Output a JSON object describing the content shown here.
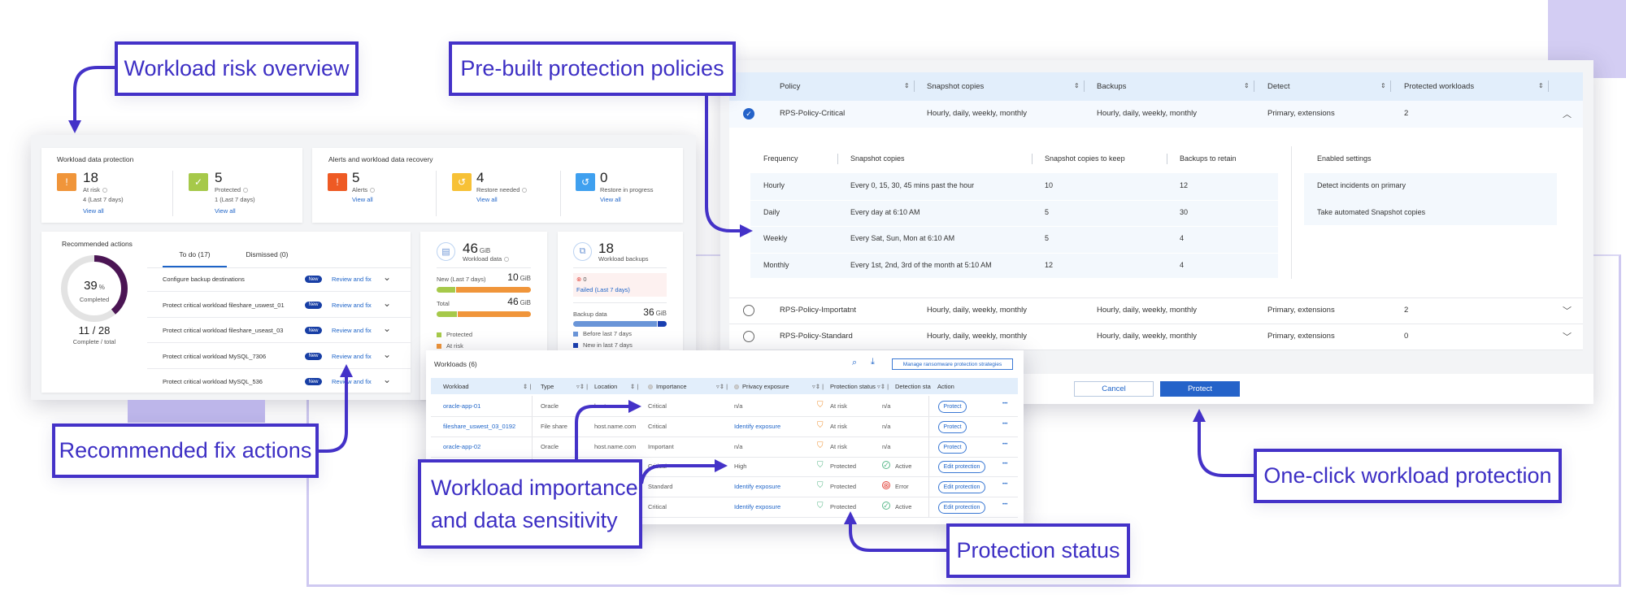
{
  "colors": {
    "accent": "#4432c8",
    "callout_text": "#3d2fc4",
    "link": "#1e64c8",
    "primary_button": "#2563c9",
    "badge": "#173ea5",
    "at_risk": "#f0953a",
    "protected": "#a6c94a",
    "alert": "#ee5a24",
    "restore_needed": "#f7c136",
    "restore_progress": "#3fa0ef",
    "ring": "#4b1554"
  },
  "callouts": {
    "risk_overview": "Workload risk overview",
    "policies": "Pre-built protection policies",
    "fix_actions": "Recommended fix actions",
    "importance": [
      "Workload importance",
      "and data sensitivity"
    ],
    "protection_status": "Protection status",
    "one_click": "One-click workload protection"
  },
  "dashboard": {
    "protection": {
      "title": "Workload data protection",
      "items": [
        {
          "value": "18",
          "label": "At risk",
          "sub": "4 (Last 7 days)",
          "link": "View all",
          "icon": "shield-alert-icon"
        },
        {
          "value": "5",
          "label": "Protected",
          "sub": "1 (Last 7 days)",
          "link": "View all",
          "icon": "shield-check-icon"
        }
      ]
    },
    "alerts": {
      "title": "Alerts and workload data recovery",
      "items": [
        {
          "value": "5",
          "label": "Alerts",
          "link": "View all",
          "icon": "alert-icon"
        },
        {
          "value": "4",
          "label": "Restore needed",
          "link": "View all",
          "icon": "restore-icon"
        },
        {
          "value": "0",
          "label": "Restore in progress",
          "link": "View all",
          "icon": "restore-progress-icon"
        }
      ]
    },
    "recommended": {
      "title": "Recommended actions",
      "percent": "39",
      "percent_unit": "%",
      "completed_label": "Completed",
      "progress": 0.39,
      "fraction": "11 / 28",
      "fraction_label": "Complete / total",
      "tabs": [
        "To do (17)",
        "Dismissed (0)"
      ],
      "active_tab": 0,
      "badge": "New",
      "action": "Review and fix",
      "rows": [
        "Configure backup destinations",
        "Protect critical workload fileshare_uswest_01",
        "Protect critical workload fileshare_useast_03",
        "Protect critical workload MySQL_7306",
        "Protect critical workload MySQL_536"
      ]
    },
    "workload_data": {
      "value": "46",
      "unit": "GiB",
      "label": "Workload data",
      "new_label": "New (Last 7 days)",
      "new_value": "10",
      "new_protected_pct": 20,
      "total_label": "Total",
      "total_value": "46",
      "total_protected_pct": 22,
      "legend": [
        "Protected",
        "At risk"
      ]
    },
    "backups": {
      "value": "18",
      "label": "Workload backups",
      "failed_count": "0",
      "failed_label": "Failed (Last 7 days)",
      "backup_label": "Backup data",
      "backup_value": "36",
      "unit": "GiB",
      "new_pct": 10,
      "legend": [
        "Before last 7 days",
        "New in last 7 days"
      ]
    }
  },
  "policies": {
    "headers": [
      "Policy",
      "Snapshot copies",
      "Backups",
      "Detect",
      "Protected workloads"
    ],
    "rows": [
      {
        "name": "RPS-Policy-Critical",
        "snapshots": "Hourly, daily, weekly, monthly",
        "backups": "Hourly, daily, weekly, monthly",
        "detect": "Primary, extensions",
        "protected": "2",
        "selected": true,
        "expanded": true
      },
      {
        "name": "RPS-Policy-Importatnt",
        "snapshots": "Hourly, daily, weekly, monthly",
        "backups": "Hourly, daily, weekly, monthly",
        "detect": "Primary, extensions",
        "protected": "2",
        "selected": false,
        "expanded": false
      },
      {
        "name": "RPS-Policy-Standard",
        "snapshots": "Hourly, daily, weekly, monthly",
        "backups": "Hourly, daily, weekly, monthly",
        "detect": "Primary, extensions",
        "protected": "0",
        "selected": false,
        "expanded": false
      }
    ],
    "detail": {
      "headers": [
        "Frequency",
        "Snapshot copies",
        "Snapshot copies to keep",
        "Backups to retain"
      ],
      "rows": [
        [
          "Hourly",
          "Every 0, 15, 30, 45 mins past the hour",
          "10",
          "12"
        ],
        [
          "Daily",
          "Every day at 6:10 AM",
          "5",
          "30"
        ],
        [
          "Weekly",
          "Every Sat, Sun, Mon at 6:10 AM",
          "5",
          "4"
        ],
        [
          "Monthly",
          "Every 1st, 2nd, 3rd of the month at 5:10 AM",
          "12",
          "4"
        ]
      ],
      "enabled_header": "Enabled settings",
      "enabled": [
        "Detect incidents on primary",
        "Take automated Snapshot copies"
      ]
    },
    "cancel": "Cancel",
    "protect": "Protect"
  },
  "workloads": {
    "title": "Workloads (6)",
    "manage": "Manage ransomware protection strategies",
    "headers": [
      "Workload",
      "Type",
      "Location",
      "Importance",
      "Privacy exposure",
      "Protection status",
      "Detection sta",
      "Action"
    ],
    "rows": [
      {
        "workload": "oracle-app-01",
        "type": "Oracle",
        "location": "host.name.com",
        "importance": "Critical",
        "privacy": "n/a",
        "status": "At risk",
        "detection": "n/a",
        "action": "Protect"
      },
      {
        "workload": "fileshare_uswest_03_0192",
        "type": "File share",
        "location": "host.name.com",
        "importance": "Critical",
        "privacy": "Identify exposure",
        "status": "At risk",
        "detection": "n/a",
        "action": "Protect"
      },
      {
        "workload": "oracle-app-02",
        "type": "Oracle",
        "location": "host.name.com",
        "importance": "Important",
        "privacy": "n/a",
        "status": "At risk",
        "detection": "n/a",
        "action": "Protect"
      },
      {
        "workload": "",
        "type": "",
        "location": "",
        "importance": "Critical",
        "privacy": "High",
        "status": "Protected",
        "detection": "Active",
        "action": "Edit protection"
      },
      {
        "workload": "",
        "type": "",
        "location": "",
        "importance": "Standard",
        "privacy": "Identify exposure",
        "status": "Protected",
        "detection": "Error",
        "action": "Edit protection"
      },
      {
        "workload": "",
        "type": "",
        "location": "",
        "importance": "Critical",
        "privacy": "Identify exposure",
        "status": "Protected",
        "detection": "Active",
        "action": "Edit protection"
      }
    ]
  }
}
